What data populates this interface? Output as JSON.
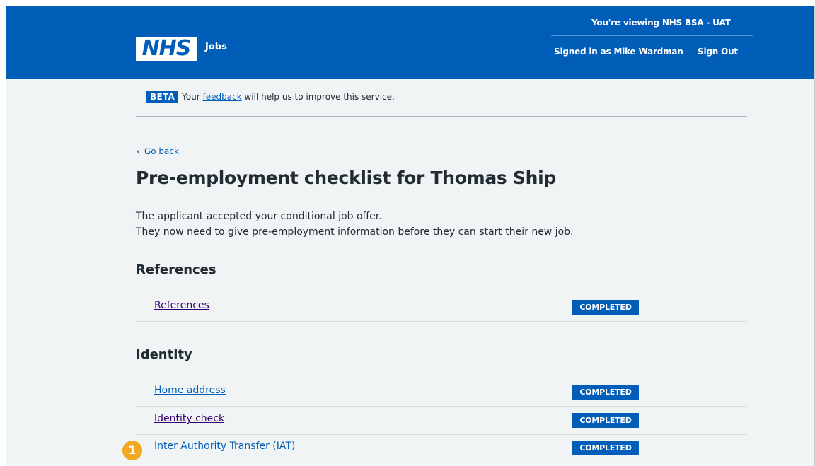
{
  "header": {
    "viewing_text": "You're viewing NHS BSA - UAT",
    "logo_text": "NHS",
    "service_name": "Jobs",
    "signed_in_text": "Signed in as Mike Wardman",
    "sign_out_label": "Sign Out"
  },
  "beta": {
    "tag": "BETA",
    "prefix": "Your ",
    "link": "feedback",
    "suffix": " will help us to improve this service."
  },
  "nav": {
    "back_label": "Go back"
  },
  "page": {
    "title": "Pre-employment checklist for Thomas Ship",
    "intro_line1": "The applicant accepted your conditional job offer.",
    "intro_line2": "They now need to give pre-employment information before they can start their new job."
  },
  "sections": [
    {
      "heading": "References",
      "tasks": [
        {
          "label": "References",
          "status": "COMPLETED"
        }
      ]
    },
    {
      "heading": "Identity",
      "tasks": [
        {
          "label": "Home address",
          "status": "COMPLETED"
        },
        {
          "label": "Identity check",
          "status": "COMPLETED"
        },
        {
          "label": "Inter Authority Transfer (IAT)",
          "status": "COMPLETED"
        }
      ]
    }
  ],
  "callout": {
    "number": "1"
  },
  "colors": {
    "nhs_blue": "#005eb8",
    "background": "#f0f4f5",
    "visited_link": "#330072",
    "callout": "#f3a81f"
  }
}
